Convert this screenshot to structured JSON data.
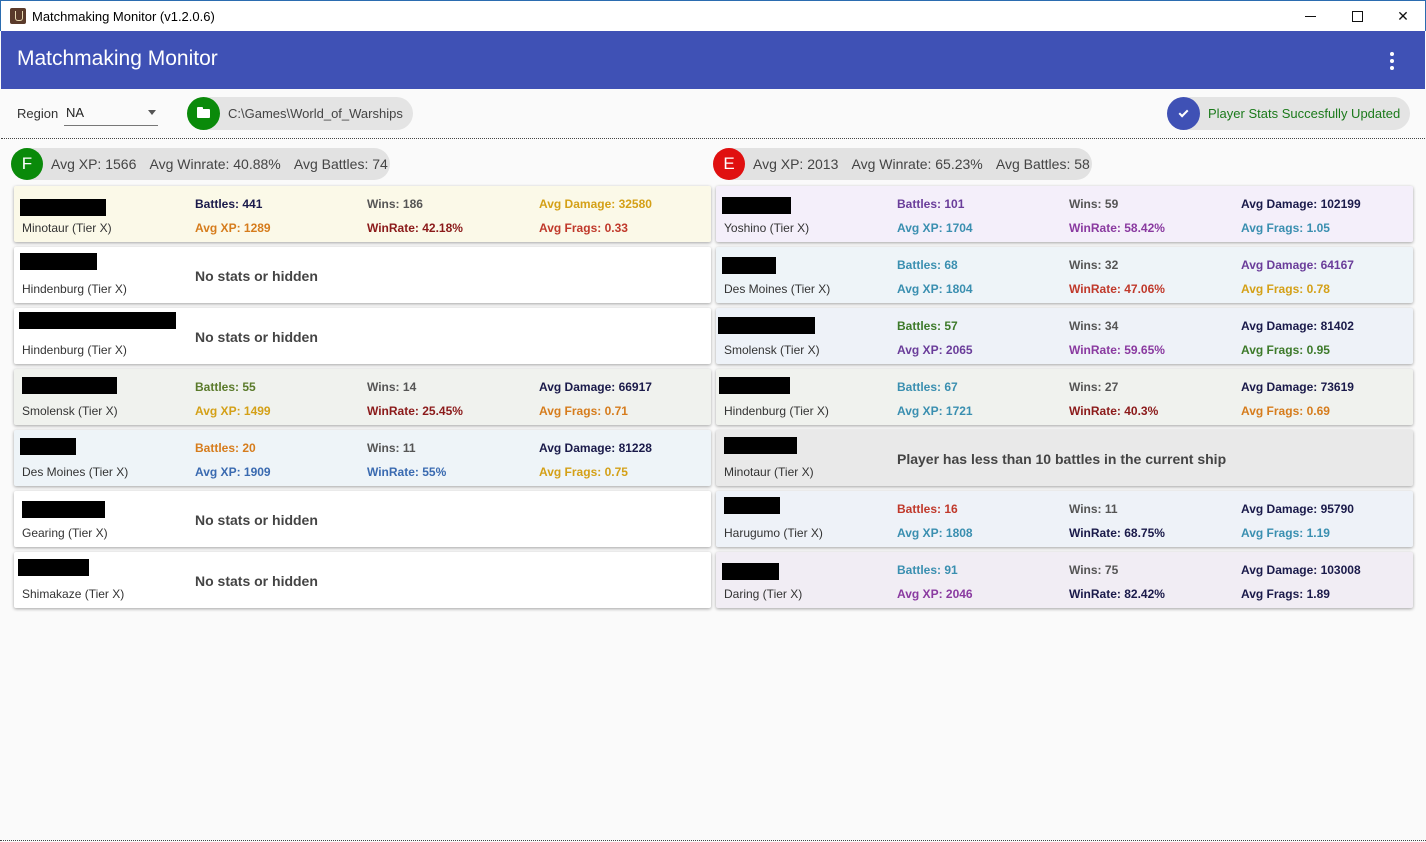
{
  "window": {
    "title": "Matchmaking Monitor (v1.2.0.6)",
    "controls": [
      "minimize-icon",
      "maximize-icon",
      "close-icon"
    ],
    "close_glyph": "✕"
  },
  "appbar": {
    "title": "Matchmaking Monitor",
    "accent": "#3f51b5"
  },
  "toolbar": {
    "region_label": "Region",
    "region_value": "NA",
    "path": "C:\\Games\\World_of_Warships",
    "status": "Player Stats Succesfully Updated"
  },
  "friendly": {
    "badge": "F",
    "badge_color": "#0a8a0a",
    "avg_xp": "Avg XP: 1566",
    "avg_winrate": "Avg Winrate: 40.88%",
    "avg_battles": "Avg Battles: 74",
    "players": [
      {
        "ship": "Minotaur (Tier X)",
        "bg": "#fbf9e8",
        "battles": "Battles: 441",
        "wins": "Wins: 186",
        "avg_damage": "Avg Damage: 32580",
        "avg_xp": "Avg XP: 1289",
        "winrate": "WinRate: 42.18%",
        "avg_frags": "Avg Frags: 0.33",
        "colors": {
          "battles": "dark",
          "wins": "gray",
          "avg_damage": "gold",
          "avg_xp": "orange",
          "winrate": "darkred",
          "avg_frags": "red"
        }
      },
      {
        "ship": "Hindenburg (Tier X)",
        "bg": "#ffffff",
        "message": "No stats or hidden"
      },
      {
        "ship": "Hindenburg (Tier X)",
        "bg": "#ffffff",
        "message": "No stats or hidden"
      },
      {
        "ship": "Smolensk (Tier X)",
        "bg": "#f0f2ee",
        "battles": "Battles: 55",
        "wins": "Wins: 14",
        "avg_damage": "Avg Damage: 66917",
        "avg_xp": "Avg XP: 1499",
        "winrate": "WinRate: 25.45%",
        "avg_frags": "Avg Frags: 0.71",
        "colors": {
          "battles": "olive",
          "wins": "gray",
          "avg_damage": "dark",
          "avg_xp": "gold",
          "winrate": "darkred",
          "avg_frags": "orange"
        }
      },
      {
        "ship": "Des Moines (Tier X)",
        "bg": "#eef4f8",
        "battles": "Battles: 20",
        "wins": "Wins: 11",
        "avg_damage": "Avg Damage: 81228",
        "avg_xp": "Avg XP: 1909",
        "winrate": "WinRate: 55%",
        "avg_frags": "Avg Frags: 0.75",
        "colors": {
          "battles": "orange",
          "wins": "gray",
          "avg_damage": "dark",
          "avg_xp": "blue",
          "winrate": "blue",
          "avg_frags": "gold"
        }
      },
      {
        "ship": "Gearing (Tier X)",
        "bg": "#ffffff",
        "message": "No stats or hidden"
      },
      {
        "ship": "Shimakaze (Tier X)",
        "bg": "#ffffff",
        "message": "No stats or hidden"
      }
    ]
  },
  "enemy": {
    "badge": "E",
    "badge_color": "#e01010",
    "avg_xp": "Avg XP: 2013",
    "avg_winrate": "Avg Winrate: 65.23%",
    "avg_battles": "Avg Battles: 58",
    "players": [
      {
        "ship": "Yoshino (Tier X)",
        "bg": "#f4effa",
        "battles": "Battles: 101",
        "wins": "Wins: 59",
        "avg_damage": "Avg Damage: 102199",
        "avg_xp": "Avg XP: 1704",
        "winrate": "WinRate: 58.42%",
        "avg_frags": "Avg Frags: 1.05",
        "colors": {
          "battles": "purple",
          "wins": "gray",
          "avg_damage": "dark",
          "avg_xp": "teal",
          "winrate": "magenta",
          "avg_frags": "teal"
        }
      },
      {
        "ship": "Des Moines (Tier X)",
        "bg": "#eef4f8",
        "battles": "Battles: 68",
        "wins": "Wins: 32",
        "avg_damage": "Avg Damage: 64167",
        "avg_xp": "Avg XP: 1804",
        "winrate": "WinRate: 47.06%",
        "avg_frags": "Avg Frags: 0.78",
        "colors": {
          "battles": "teal",
          "wins": "gray",
          "avg_damage": "purple",
          "avg_xp": "teal",
          "winrate": "red",
          "avg_frags": "gold"
        }
      },
      {
        "ship": "Smolensk (Tier X)",
        "bg": "#eef2f8",
        "battles": "Battles: 57",
        "wins": "Wins: 34",
        "avg_damage": "Avg Damage: 81402",
        "avg_xp": "Avg XP: 2065",
        "winrate": "WinRate: 59.65%",
        "avg_frags": "Avg Frags: 0.95",
        "colors": {
          "battles": "green",
          "wins": "gray",
          "avg_damage": "dark",
          "avg_xp": "purple",
          "winrate": "magenta",
          "avg_frags": "green"
        }
      },
      {
        "ship": "Hindenburg (Tier X)",
        "bg": "#f0f2ee",
        "battles": "Battles: 67",
        "wins": "Wins: 27",
        "avg_damage": "Avg Damage: 73619",
        "avg_xp": "Avg XP: 1721",
        "winrate": "WinRate: 40.3%",
        "avg_frags": "Avg Frags: 0.69",
        "colors": {
          "battles": "teal",
          "wins": "gray",
          "avg_damage": "dark",
          "avg_xp": "teal",
          "winrate": "darkred",
          "avg_frags": "orange"
        }
      },
      {
        "ship": "Minotaur (Tier X)",
        "bg": "#e9e9e9",
        "message": "Player has less than 10 battles in the current ship"
      },
      {
        "ship": "Harugumo (Tier X)",
        "bg": "#eef2f8",
        "battles": "Battles: 16",
        "wins": "Wins: 11",
        "avg_damage": "Avg Damage: 95790",
        "avg_xp": "Avg XP: 1808",
        "winrate": "WinRate: 68.75%",
        "avg_frags": "Avg Frags: 1.19",
        "colors": {
          "battles": "red",
          "wins": "gray",
          "avg_damage": "dark",
          "avg_xp": "teal",
          "winrate": "dark",
          "avg_frags": "teal"
        }
      },
      {
        "ship": "Daring (Tier X)",
        "bg": "#f1edf4",
        "battles": "Battles: 91",
        "wins": "Wins: 75",
        "avg_damage": "Avg Damage: 103008",
        "avg_xp": "Avg XP: 2046",
        "winrate": "WinRate: 82.42%",
        "avg_frags": "Avg Frags: 1.89",
        "colors": {
          "battles": "teal",
          "wins": "gray",
          "avg_damage": "dark",
          "avg_xp": "magenta",
          "winrate": "dark",
          "avg_frags": "dark"
        }
      }
    ]
  }
}
